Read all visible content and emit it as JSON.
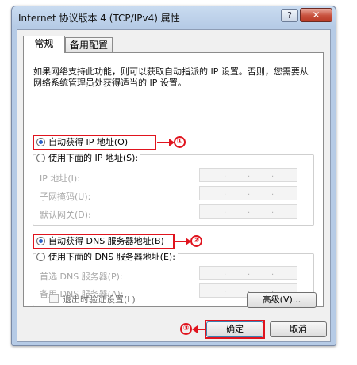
{
  "window": {
    "title": "Internet 协议版本 4 (TCP/IPv4) 属性",
    "help_glyph": "?",
    "close_glyph": "✕"
  },
  "tabs": [
    {
      "label": "常规",
      "active": true
    },
    {
      "label": "备用配置",
      "active": false
    }
  ],
  "description": "如果网络支持此功能，则可以获取自动指派的 IP 设置。否则，您需要从网络系统管理员处获得适当的 IP 设置。",
  "ip": {
    "auto_label": "自动获得 IP 地址(O)",
    "auto_selected": true,
    "manual_label": "使用下面的 IP 地址(S):",
    "fields": [
      {
        "label": "IP 地址(I):",
        "value": ".   .   ."
      },
      {
        "label": "子网掩码(U):",
        "value": ".   .   ."
      },
      {
        "label": "默认网关(D):",
        "value": ".   .   ."
      }
    ]
  },
  "dns": {
    "auto_label": "自动获得 DNS 服务器地址(B)",
    "auto_selected": true,
    "manual_label": "使用下面的 DNS 服务器地址(E):",
    "fields": [
      {
        "label": "首选 DNS 服务器(P):",
        "value": ".   .   ."
      },
      {
        "label": "备用 DNS 服务器(A):",
        "value": ".   .   ."
      }
    ]
  },
  "validate_label": "退出时验证设置(L)",
  "advanced_label": "高级(V)...",
  "ok_label": "确定",
  "cancel_label": "取消",
  "annotations": {
    "one": "①",
    "two": "②",
    "three": "③",
    "highlight_color": "#e0141e"
  }
}
